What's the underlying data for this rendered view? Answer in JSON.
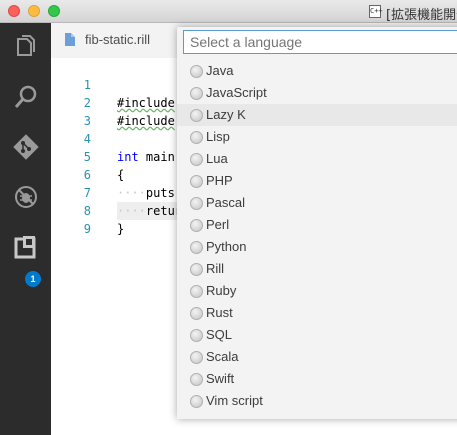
{
  "window": {
    "title": "[拡張機能開発",
    "app_icon_text": "C++"
  },
  "activity_bar": {
    "items": [
      {
        "name": "explorer-icon"
      },
      {
        "name": "search-icon"
      },
      {
        "name": "git-icon"
      },
      {
        "name": "debug-icon"
      },
      {
        "name": "extensions-icon"
      }
    ],
    "extensions_badge": "1"
  },
  "tab": {
    "label": "fib-static.rill"
  },
  "editor": {
    "lines": [
      {
        "num": "1",
        "text": "#include"
      },
      {
        "num": "2",
        "text": "#include"
      },
      {
        "num": "3",
        "text": ""
      },
      {
        "num": "4",
        "kw": "int",
        "text": " main("
      },
      {
        "num": "5",
        "text": "{"
      },
      {
        "num": "6",
        "ws": "····",
        "text": "puts("
      },
      {
        "num": "7",
        "ws": "····",
        "text": "retur"
      },
      {
        "num": "8",
        "text": "}"
      },
      {
        "num": "9",
        "text": ""
      }
    ]
  },
  "quick_pick": {
    "placeholder": "Select a language",
    "highlighted_index": 2,
    "items": [
      "Java",
      "JavaScript",
      "Lazy K",
      "Lisp",
      "Lua",
      "PHP",
      "Pascal",
      "Perl",
      "Python",
      "Rill",
      "Ruby",
      "Rust",
      "SQL",
      "Scala",
      "Swift",
      "Vim script"
    ]
  },
  "colors": {
    "activity_bg": "#2c2c2c",
    "badge": "#007acc",
    "line_number": "#2b91af",
    "keyword": "#0000ff"
  }
}
